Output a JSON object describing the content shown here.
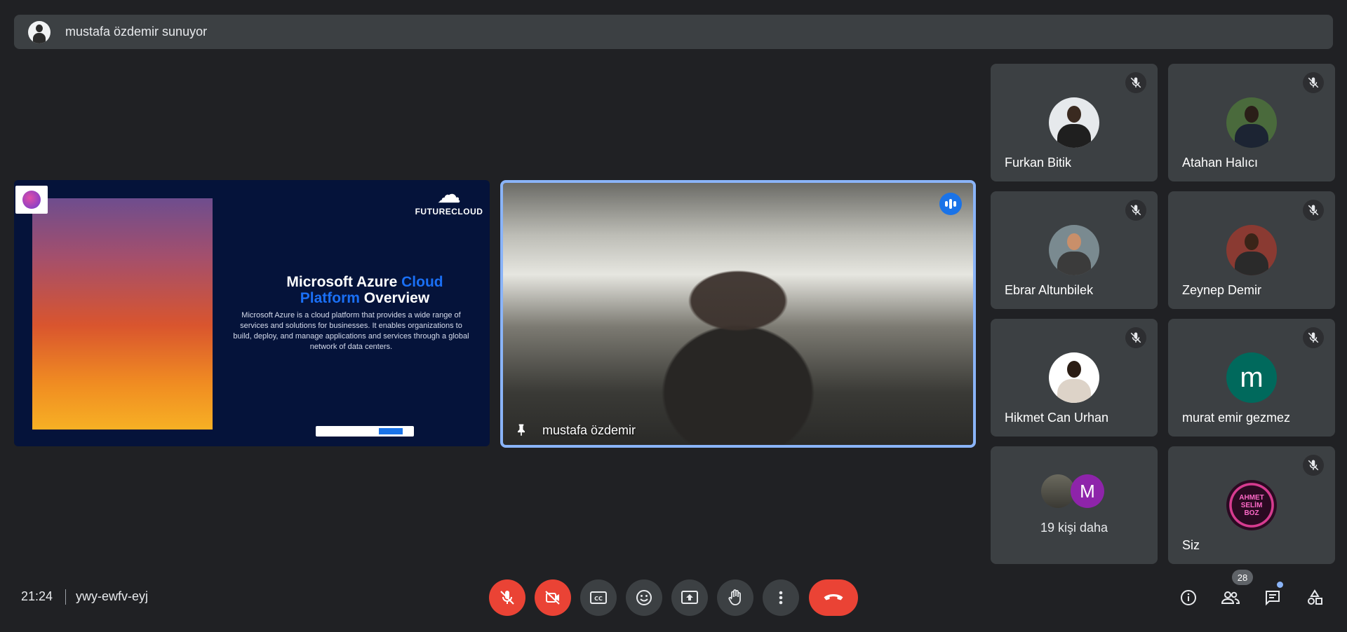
{
  "banner": {
    "text": "mustafa özdemir sunuyor"
  },
  "slide": {
    "brand": "FUTURECLOUD",
    "title_part1": "Microsoft Azure ",
    "title_accent1": "Cloud",
    "title_accent2": "Platform",
    "title_part2": " Overview",
    "body": "Microsoft Azure is a cloud platform that provides a wide range of services and solutions for businesses. It enables organizations to build, deploy, and manage applications and services through a global network of data centers."
  },
  "presenter_video": {
    "name": "mustafa özdemir"
  },
  "participants": [
    {
      "name": "Furkan Bitik"
    },
    {
      "name": "Atahan Halıcı"
    },
    {
      "name": "Ebrar Altunbilek"
    },
    {
      "name": "Zeynep Demir"
    },
    {
      "name": "Hikmet Can Urhan"
    },
    {
      "name": "murat emir gezmez",
      "initial": "m",
      "color": "#00695c"
    }
  ],
  "more_tile": {
    "label": "19 kişi daha",
    "initial": "M",
    "color": "#8e24aa"
  },
  "self_tile": {
    "name": "Siz",
    "avatar_text": "AHMET SELİM BOZ"
  },
  "footer": {
    "time": "21:24",
    "meeting_code": "ywy-ewfv-eyj",
    "people_count": "28"
  },
  "icons": {
    "mic": "mic-off-icon",
    "camera": "camera-off-icon",
    "captions": "captions-icon",
    "emoji": "emoji-icon",
    "present": "present-screen-icon",
    "hand": "raise-hand-icon",
    "more": "more-options-icon",
    "leave": "call-end-icon",
    "info": "info-icon",
    "people": "people-icon",
    "chat": "chat-icon",
    "activities": "activities-icon"
  },
  "colors": {
    "accent": "#8ab4f8",
    "danger": "#ea4335",
    "tile": "#3c4043",
    "bg": "#202124"
  }
}
